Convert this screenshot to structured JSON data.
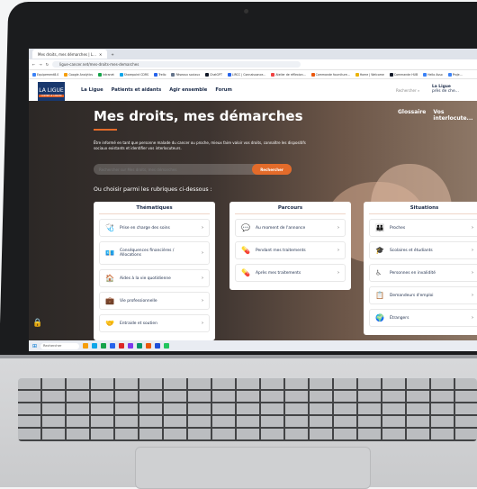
{
  "browser": {
    "tab_title": "Mes droits, mes démarches | L...",
    "url": "ligue-cancer.net/mes-droits-mes-demarches",
    "bookmarks": [
      {
        "label": "Equipement8.0",
        "color": "#3b82f6"
      },
      {
        "label": "Google Analytics",
        "color": "#f59e0b"
      },
      {
        "label": "Intranet",
        "color": "#16a34a"
      },
      {
        "label": "Sharepoint CDRS",
        "color": "#0ea5e9"
      },
      {
        "label": "Trello",
        "color": "#2563eb"
      },
      {
        "label": "Réseaux sociaux",
        "color": "#64748b"
      },
      {
        "label": "ChatGPT",
        "color": "#111827"
      },
      {
        "label": "LIRCC | Connaissance...",
        "color": "#2563eb"
      },
      {
        "label": "Atelier de réflexion...",
        "color": "#ef4444"
      },
      {
        "label": "Commande fourniture...",
        "color": "#ea580c"
      },
      {
        "label": "Home | Welcome",
        "color": "#eab308"
      },
      {
        "label": "Commande HUB",
        "color": "#111827"
      },
      {
        "label": "Hello Asso",
        "color": "#3b82f6"
      },
      {
        "label": "Proje...",
        "color": "#3b82f6"
      }
    ]
  },
  "site": {
    "logo_title": "LA LIGUE",
    "logo_subtitle": "CONTRE LE CANCER",
    "nav": [
      "La Ligue",
      "Patients et aidants",
      "Agir ensemble",
      "Forum"
    ],
    "search_label": "Rechercher",
    "user_line1": "La Ligue",
    "user_line2": "près de che..."
  },
  "hero": {
    "title": "Mes droits, mes démarches",
    "links": [
      "Glossaire",
      "Vos interlocute..."
    ],
    "description": "Être informé en tant que personne malade du cancer ou proche, mieux faire valoir vos droits, connaître les dispositifs sociaux existants et identifier vos interlocuteurs.",
    "search_placeholder": "Rechercher sur Mes droits, mes démarches",
    "search_button": "Rechercher",
    "choose_label": "Ou choisir parmi les rubriques ci-dessous :"
  },
  "panels": [
    {
      "title": "Thématiques",
      "items": [
        {
          "label": "Prise en charge des soins",
          "icon": "🩺"
        },
        {
          "label": "Conséquences financières / Allocations",
          "icon": "💶"
        },
        {
          "label": "Aides à la vie quotidienne",
          "icon": "🏠"
        },
        {
          "label": "Vie professionnelle",
          "icon": "💼"
        },
        {
          "label": "Entraide et soutien",
          "icon": "🤝"
        }
      ]
    },
    {
      "title": "Parcours",
      "items": [
        {
          "label": "Au moment de l'annonce",
          "icon": "💬"
        },
        {
          "label": "Pendant mes traitements",
          "icon": "💊"
        },
        {
          "label": "Après mes traitements",
          "icon": "💊"
        }
      ]
    },
    {
      "title": "Situations",
      "items": [
        {
          "label": "Proches",
          "icon": "👪"
        },
        {
          "label": "Scolaires et étudiants",
          "icon": "🎓"
        },
        {
          "label": "Personnes en invalidité",
          "icon": "♿"
        },
        {
          "label": "Demandeurs d'emploi",
          "icon": "📋"
        },
        {
          "label": "Étrangers",
          "icon": "🌍"
        }
      ]
    }
  ],
  "taskbar": {
    "search_label": "Rechercher"
  }
}
